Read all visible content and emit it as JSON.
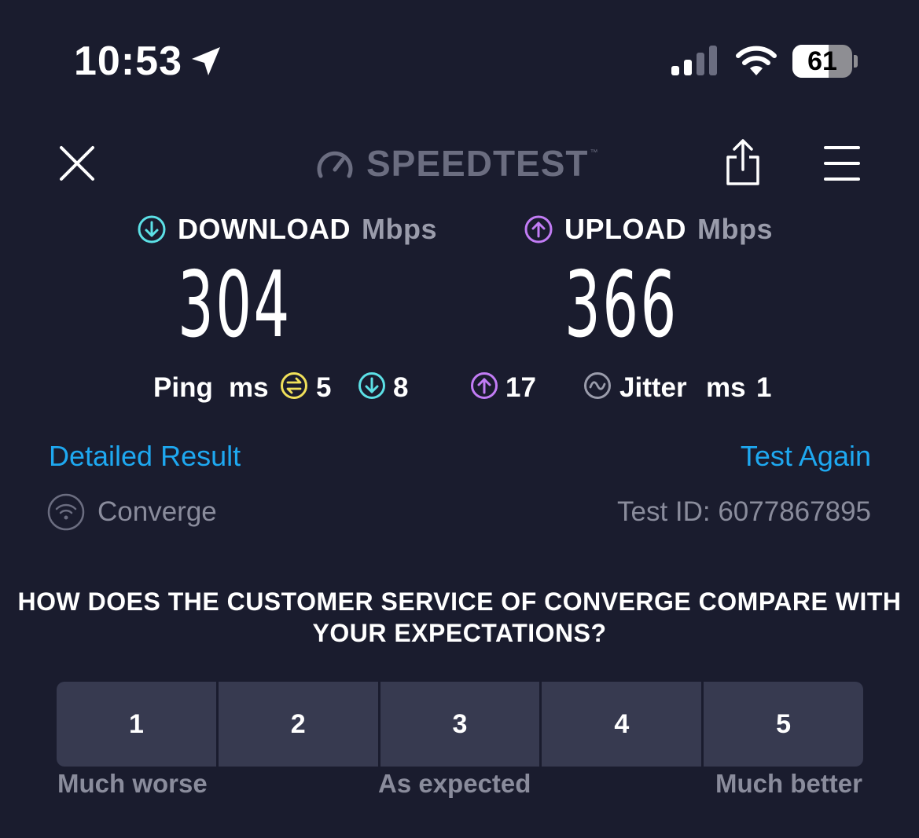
{
  "status_bar": {
    "time": "10:53",
    "battery": "61",
    "battery_level": 0.61
  },
  "header": {
    "logo_text": "SPEEDTEST",
    "logo_mark": "™"
  },
  "download": {
    "label": "DOWNLOAD",
    "unit": "Mbps",
    "value": "304",
    "color": "#5ce0e6"
  },
  "upload": {
    "label": "UPLOAD",
    "unit": "Mbps",
    "value": "366",
    "color": "#c27cf5"
  },
  "ping": {
    "label": "Ping",
    "unit": "ms",
    "idle": "5",
    "download": "8",
    "upload": "17",
    "idle_color": "#f0e05a"
  },
  "jitter": {
    "label": "Jitter",
    "unit": "ms",
    "value": "1"
  },
  "links": {
    "detailed": "Detailed Result",
    "again": "Test Again"
  },
  "provider": {
    "name": "Converge",
    "test_id": "Test ID: 6077867895"
  },
  "survey": {
    "question": "HOW DOES THE CUSTOMER SERVICE OF CONVERGE COMPARE WITH YOUR EXPECTATIONS?",
    "options": [
      "1",
      "2",
      "3",
      "4",
      "5"
    ],
    "low_label": "Much worse",
    "mid_label": "As expected",
    "high_label": "Much better"
  },
  "colors": {
    "background": "#1a1c2e",
    "link": "#1ea8f0",
    "button": "#373a50"
  }
}
